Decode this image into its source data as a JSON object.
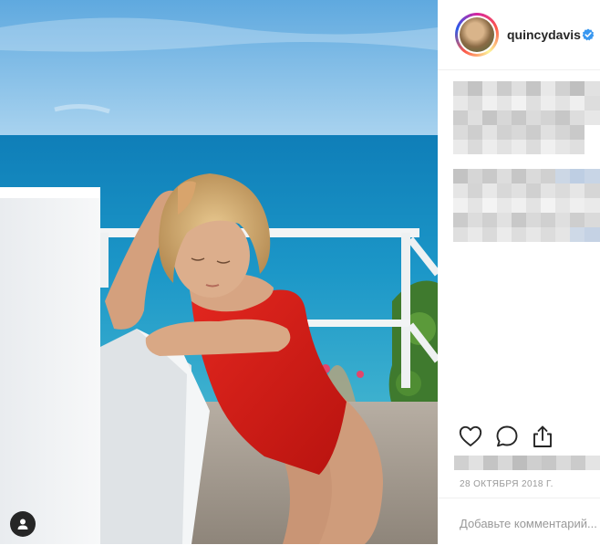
{
  "post": {
    "username": "quincydavis",
    "verified": true,
    "date": "28 ОКТЯБРЯ 2018 Г.",
    "comment_placeholder": "Добавьте комментарий..."
  },
  "icons": {
    "like": "heart-icon",
    "comment": "comment-icon",
    "share": "share-icon",
    "verified": "verified-badge-icon",
    "tag": "user-tag-icon"
  },
  "colors": {
    "verified": "#3897f0",
    "text": "#262626",
    "muted": "#999999",
    "swimsuit": "#d81f1a",
    "sea": "#1d8cc0"
  }
}
